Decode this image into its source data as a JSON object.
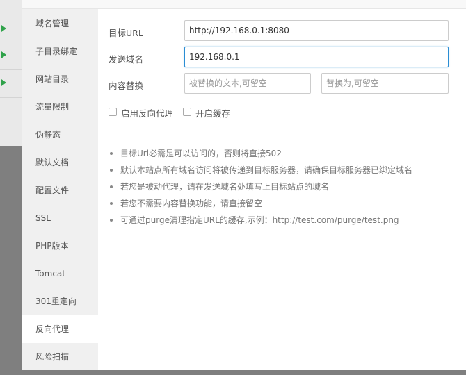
{
  "sidebar": {
    "items": [
      {
        "label": "域名管理"
      },
      {
        "label": "子目录绑定"
      },
      {
        "label": "网站目录"
      },
      {
        "label": "流量限制"
      },
      {
        "label": "伪静态"
      },
      {
        "label": "默认文档"
      },
      {
        "label": "配置文件"
      },
      {
        "label": "SSL"
      },
      {
        "label": "PHP版本"
      },
      {
        "label": "Tomcat"
      },
      {
        "label": "301重定向"
      },
      {
        "label": "反向代理",
        "active": true
      },
      {
        "label": "风险扫描"
      }
    ]
  },
  "form": {
    "target_url_label": "目标URL",
    "target_url_value": "http://192.168.0.1:8080",
    "send_domain_label": "发送域名",
    "send_domain_value": "192.168.0.1",
    "content_replace_label": "内容替换",
    "replace_from_placeholder": "被替换的文本,可留空",
    "replace_to_placeholder": "替换为,可留空",
    "enable_proxy_label": "启用反向代理",
    "enable_cache_label": "开启缓存"
  },
  "tips": [
    "目标Url必需是可以访问的，否则将直接502",
    "默认本站点所有域名访问将被传递到目标服务器，请确保目标服务器已绑定域名",
    "若您是被动代理，请在发送域名处填写上目标站点的域名",
    "若您不需要内容替换功能，请直接留空",
    "可通过purge清理指定URL的缓存,示例：http://test.com/purge/test.png"
  ],
  "colors": {
    "accent": "#2a8dd4",
    "arrow": "#2fa24a"
  }
}
